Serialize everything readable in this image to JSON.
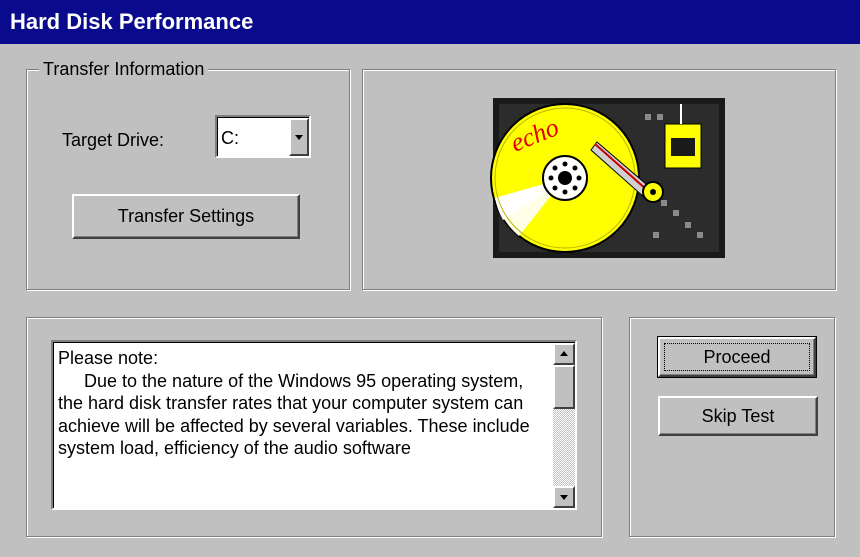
{
  "window": {
    "title": "Hard Disk Performance"
  },
  "transfer_info": {
    "group_label": "Transfer Information",
    "target_drive_label": "Target Drive:",
    "target_drive_value": "C:",
    "settings_button": "Transfer Settings"
  },
  "logo": {
    "text": "echo",
    "icon": "hard-disk-icon"
  },
  "note": {
    "heading": "Please note:",
    "body": "Due to the nature of the Windows 95 operating system, the hard disk transfer rates that your computer system can achieve will be affected by several variables. These include system load, efficiency of the audio software"
  },
  "actions": {
    "proceed": "Proceed",
    "skip": "Skip Test"
  },
  "colors": {
    "title_bar": "#0a0a8c",
    "face": "#c0c0c0",
    "platter": "#ffff00",
    "logo_text": "#e00000"
  }
}
